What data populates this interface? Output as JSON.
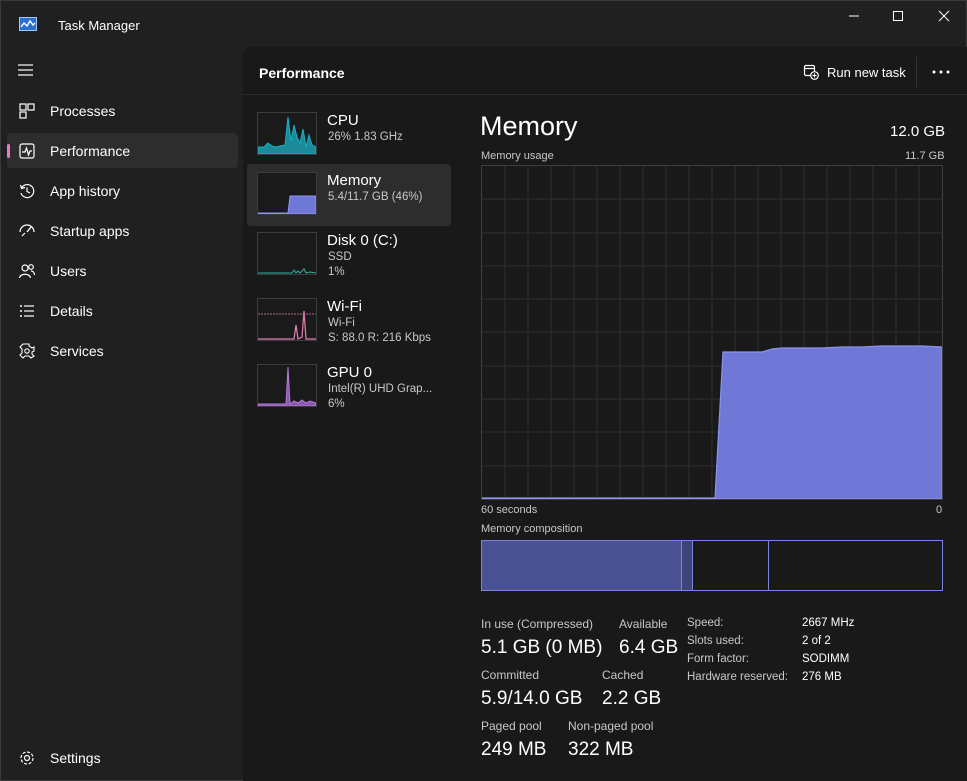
{
  "window": {
    "title": "Task Manager"
  },
  "sidebar": {
    "items": [
      {
        "label": "Processes",
        "icon": "processes-icon"
      },
      {
        "label": "Performance",
        "icon": "performance-icon",
        "active": true
      },
      {
        "label": "App history",
        "icon": "history-icon"
      },
      {
        "label": "Startup apps",
        "icon": "startup-icon"
      },
      {
        "label": "Users",
        "icon": "users-icon"
      },
      {
        "label": "Details",
        "icon": "details-icon"
      },
      {
        "label": "Services",
        "icon": "services-icon"
      }
    ],
    "settings_label": "Settings"
  },
  "header": {
    "title": "Performance",
    "run_task_label": "Run new task"
  },
  "devices": [
    {
      "name": "CPU",
      "line1": "26%  1.83 GHz",
      "line2": "",
      "color": "#17b0c3"
    },
    {
      "name": "Memory",
      "line1": "5.4/11.7 GB (46%)",
      "line2": "",
      "color": "#7b82e0"
    },
    {
      "name": "Disk 0 (C:)",
      "line1": "SSD",
      "line2": "1%",
      "color": "#2ab3a0"
    },
    {
      "name": "Wi-Fi",
      "line1": "Wi-Fi",
      "line2": "S: 88.0  R: 216 Kbps",
      "color": "#e57fb3"
    },
    {
      "name": "GPU 0",
      "line1": "Intel(R) UHD Grap...",
      "line2": "6%",
      "color": "#b27ad9"
    }
  ],
  "memory": {
    "title": "Memory",
    "total": "12.0 GB",
    "usage_label": "Memory usage",
    "usage_max": "11.7 GB",
    "axis_left": "60 seconds",
    "axis_right": "0",
    "composition_label": "Memory composition",
    "composition": {
      "in_use_fraction": 0.435,
      "modified_fraction": 0.024,
      "standby_fraction": 0.165
    },
    "stats": {
      "in_use_label": "In use (Compressed)",
      "in_use_value": "5.1 GB (0 MB)",
      "available_label": "Available",
      "available_value": "6.4 GB",
      "committed_label": "Committed",
      "committed_value": "5.9/14.0 GB",
      "cached_label": "Cached",
      "cached_value": "2.2 GB",
      "paged_label": "Paged pool",
      "paged_value": "249 MB",
      "nonpaged_label": "Non-paged pool",
      "nonpaged_value": "322 MB"
    },
    "specs": [
      {
        "key": "Speed:",
        "value": "2667 MHz"
      },
      {
        "key": "Slots used:",
        "value": "2 of 2"
      },
      {
        "key": "Form factor:",
        "value": "SODIMM"
      },
      {
        "key": "Hardware reserved:",
        "value": "276 MB"
      }
    ]
  },
  "colors": {
    "accent": "#e27bd0",
    "memory_fill": "#6f78d6",
    "memory_line": "#8c93ea"
  }
}
